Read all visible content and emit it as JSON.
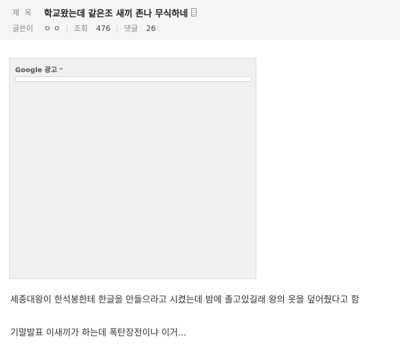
{
  "post": {
    "title_label": "제 목",
    "title": "학교왔는데 같은조 새끼 존나 무식하네",
    "title_icon": "document-icon",
    "author_label": "글쓴이",
    "author": "ㅇ ㅇ",
    "views_label": "조회",
    "views": "476",
    "comments_label": "댓글",
    "comments": "26"
  },
  "ad": {
    "label": "Google 광고"
  },
  "content": {
    "line1": "세종대왕이 한석봉한테 한글을 만들으라고 시켰는데 밤에 졸고있길래 왕의 옷을 덮어줬다고 함",
    "line2": "기말발표 이새끼가 하는데 폭탄장전이냐 이거..."
  },
  "colors": {
    "header_bg": "#f5f5f5",
    "ad_bg": "#f0f0f0",
    "label_gray": "#8a8a8a"
  }
}
